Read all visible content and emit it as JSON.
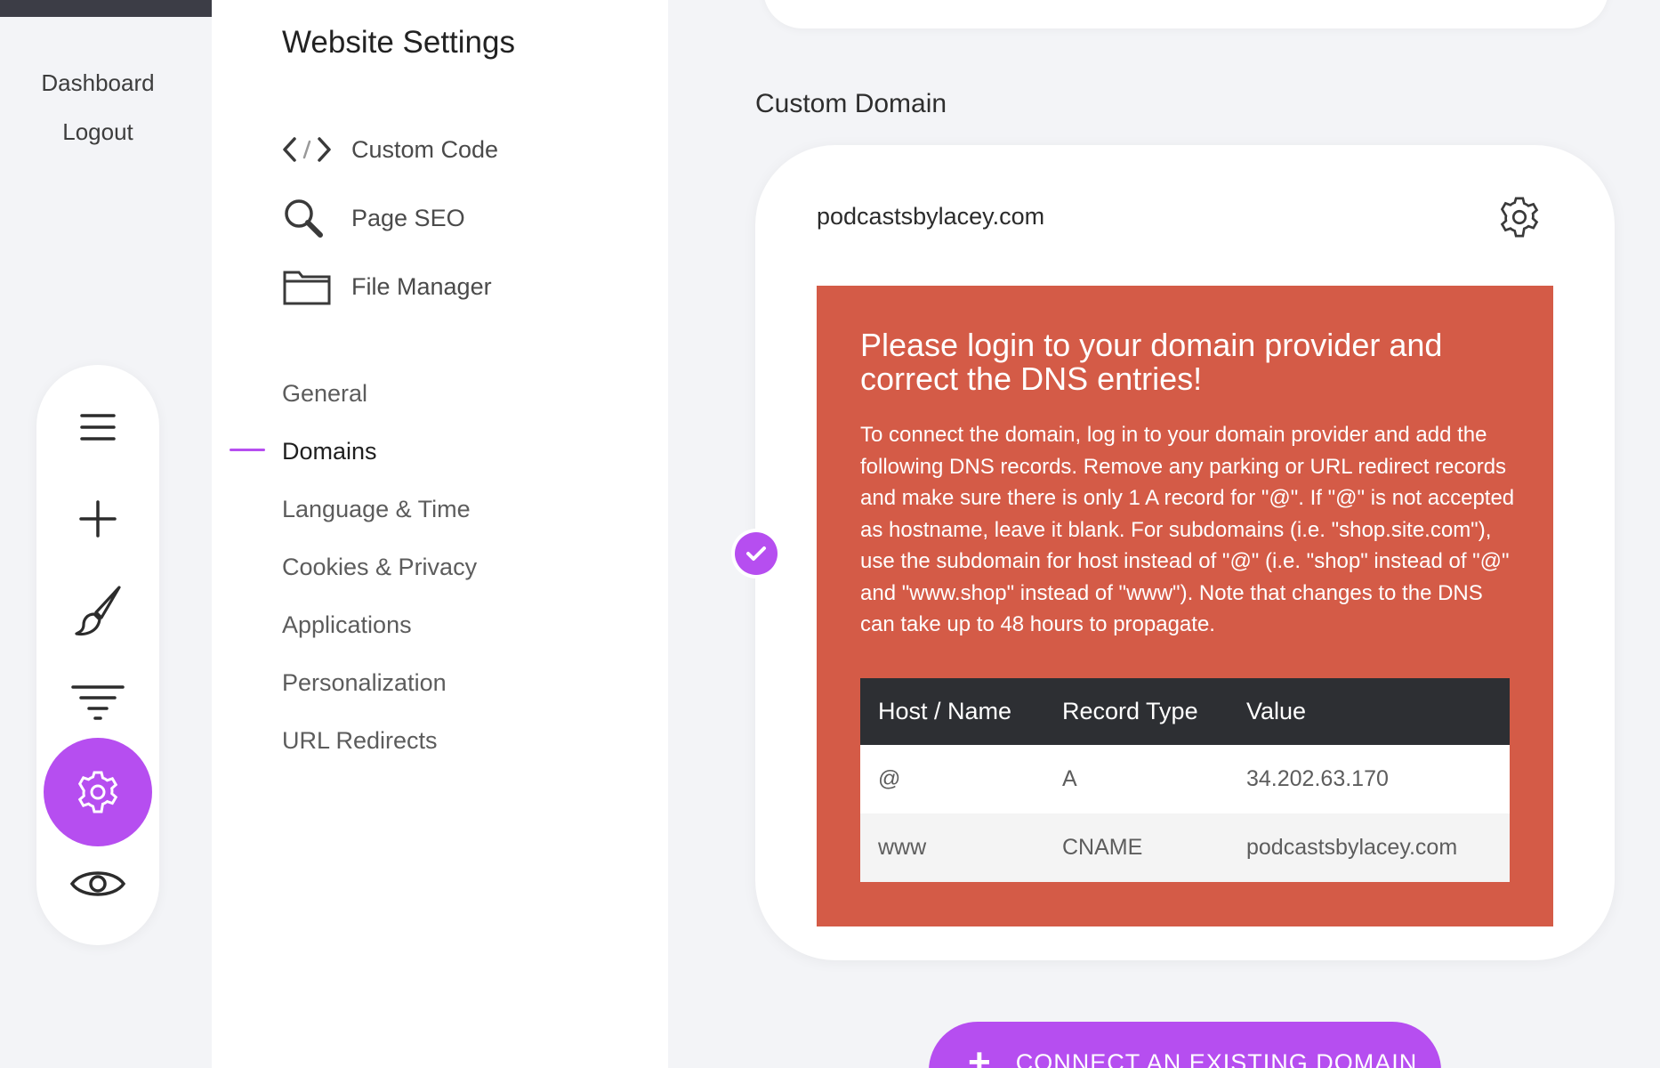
{
  "rail": {
    "dashboard_label": "Dashboard",
    "logout_label": "Logout",
    "tools": [
      "menu-icon",
      "plus-icon",
      "brush-icon",
      "filter-icon",
      "gear-icon",
      "eye-icon"
    ],
    "active_tool": "gear-icon"
  },
  "settings": {
    "title": "Website Settings",
    "tool_links": [
      {
        "label": "Custom Code",
        "icon": "code-icon"
      },
      {
        "label": "Page SEO",
        "icon": "search-icon"
      },
      {
        "label": "File Manager",
        "icon": "folder-icon"
      }
    ],
    "nav": [
      {
        "label": "General"
      },
      {
        "label": "Domains"
      },
      {
        "label": "Language & Time"
      },
      {
        "label": "Cookies & Privacy"
      },
      {
        "label": "Applications"
      },
      {
        "label": "Personalization"
      },
      {
        "label": "URL Redirects"
      }
    ],
    "active_nav": "Domains"
  },
  "main": {
    "section_heading": "Custom Domain",
    "domain": {
      "name": "podcastsbylacey.com",
      "alert_title": "Please login to your domain provider and correct the DNS entries!",
      "alert_body": "To connect the domain, log in to your domain provider and add the following DNS records. Remove any parking or URL redirect records and make sure there is only 1 A record for \"@\". If \"@\" is not accepted as hostname, leave it blank. For subdomains (i.e. \"shop.site.com\"), use the subdomain for host instead of \"@\" (i.e. \"shop\" instead of \"@\" and \"www.shop\" instead of \"www\"). Note that changes to the DNS can take up to 48 hours to propagate.",
      "table": {
        "headers": [
          "Host / Name",
          "Record Type",
          "Value"
        ],
        "rows": [
          [
            "@",
            "A",
            "34.202.63.170"
          ],
          [
            "www",
            "CNAME",
            "podcastsbylacey.com"
          ]
        ]
      }
    },
    "connect_button": {
      "icon": "plus-icon",
      "label": "CONNECT AN EXISTING DOMAIN"
    }
  },
  "colors": {
    "accent": "#b64ef0",
    "alert_bg": "#d45b47",
    "table_header_bg": "#2d2f33",
    "page_bg": "#f3f4f7"
  }
}
